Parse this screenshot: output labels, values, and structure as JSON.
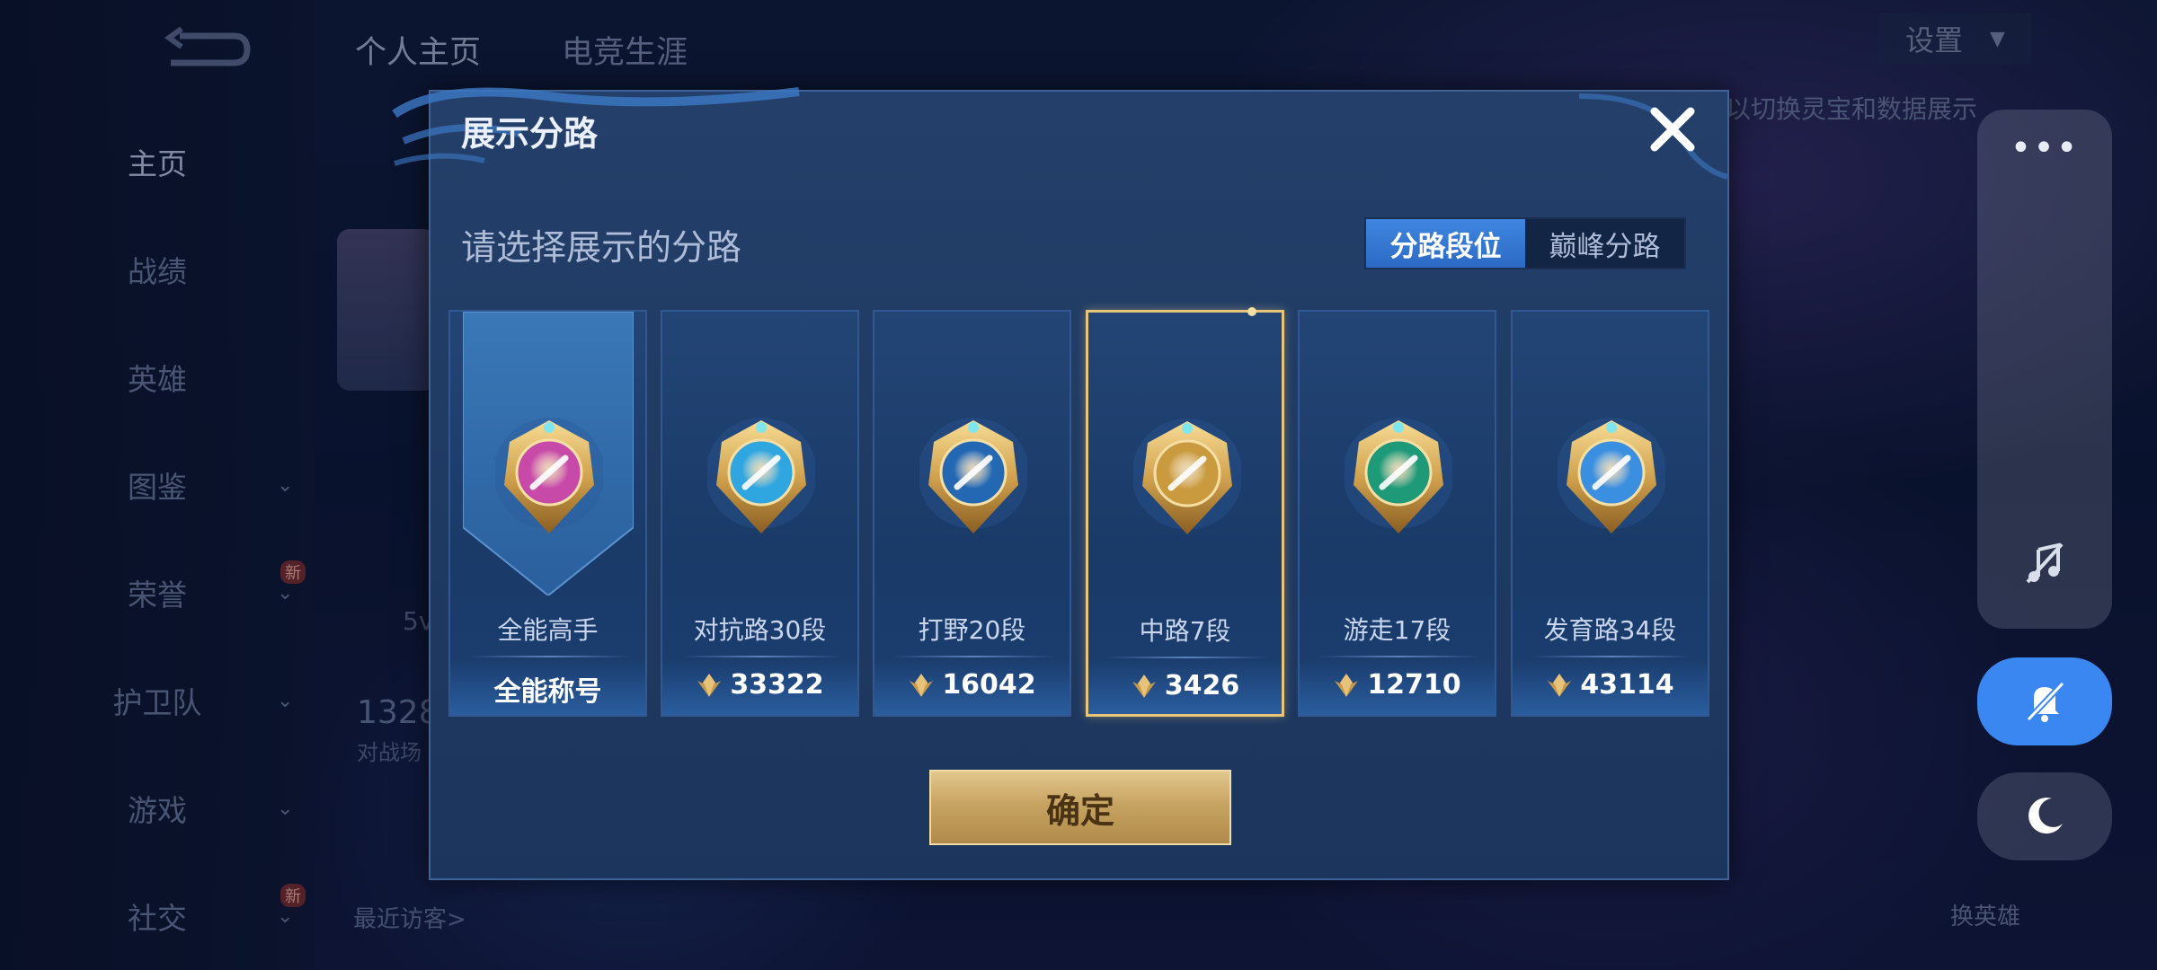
{
  "background": {
    "nav_items": [
      {
        "label": "主页",
        "active": true,
        "chevron": false,
        "badge": ""
      },
      {
        "label": "战绩",
        "active": false,
        "chevron": false,
        "badge": ""
      },
      {
        "label": "英雄",
        "active": false,
        "chevron": false,
        "badge": ""
      },
      {
        "label": "图鉴",
        "active": false,
        "chevron": true,
        "badge": ""
      },
      {
        "label": "荣誉",
        "active": false,
        "chevron": true,
        "badge": "新"
      },
      {
        "label": "护卫队",
        "active": false,
        "chevron": true,
        "badge": ""
      },
      {
        "label": "游戏",
        "active": false,
        "chevron": true,
        "badge": ""
      },
      {
        "label": "社交",
        "active": false,
        "chevron": true,
        "badge": "新"
      }
    ],
    "top_tabs": [
      "个人主页",
      "电竞生涯"
    ],
    "settings_label": "设置",
    "hint_text": "以切换灵宝和数据展示",
    "stat_number": "1328",
    "stat_sub": "对战场",
    "visitors_label": "最近访客>",
    "swap_label": "换英雄",
    "mode_label": "5v"
  },
  "toolbar": {
    "more_label": "•••"
  },
  "modal": {
    "title": "展示分路",
    "subtitle": "请选择展示的分路",
    "toggle": [
      "分路段位",
      "巅峰分路"
    ],
    "active_toggle": 0,
    "confirm_label": "确定",
    "cards": [
      {
        "name": "全能高手",
        "value": "全能称号",
        "has_gem": false,
        "selected": false,
        "badge_color": "#c84aa8"
      },
      {
        "name": "对抗路30段",
        "value": "33322",
        "has_gem": true,
        "selected": false,
        "badge_color": "#2fa6e0"
      },
      {
        "name": "打野20段",
        "value": "16042",
        "has_gem": true,
        "selected": false,
        "badge_color": "#2468b4"
      },
      {
        "name": "中路7段",
        "value": "3426",
        "has_gem": true,
        "selected": true,
        "badge_color": "#c99a3e"
      },
      {
        "name": "游走17段",
        "value": "12710",
        "has_gem": true,
        "selected": false,
        "badge_color": "#1f9a78"
      },
      {
        "name": "发育路34段",
        "value": "43114",
        "has_gem": true,
        "selected": false,
        "badge_color": "#3b8fe0"
      }
    ]
  },
  "colors": {
    "accent_blue": "#3b87f2",
    "gold": "#e9c57a",
    "modal_bg": "#213c66"
  }
}
